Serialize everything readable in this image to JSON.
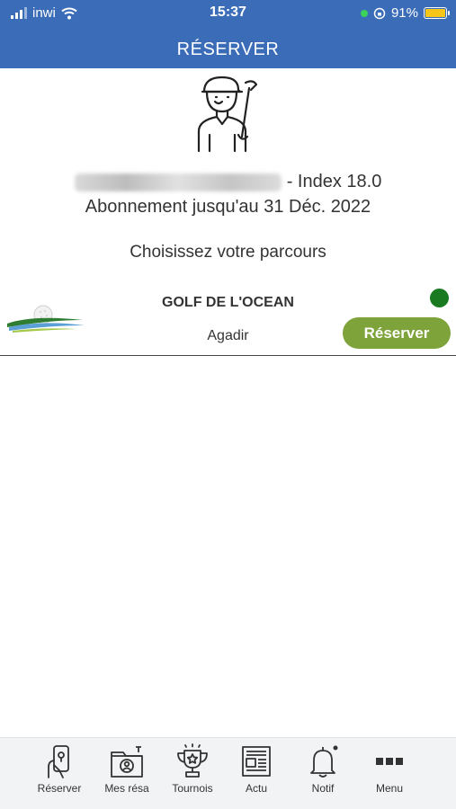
{
  "status_bar": {
    "carrier": "inwi",
    "time": "15:37",
    "battery": "91%",
    "battery_color": "#f5c518"
  },
  "header": {
    "title": "RÉSERVER",
    "color": "#3b6cb8"
  },
  "profile": {
    "index_text": "- Index 18.0",
    "subscription": "Abonnement jusqu'au 31 Déc. 2022",
    "avatar_icon": "golfer-icon"
  },
  "choose_course": "Choisissez votre parcours",
  "courses": [
    {
      "name": "GOLF DE L'OCEAN",
      "city": "Agadir",
      "logo_text": "GOLF DE L'OCEAN",
      "status_color": "#1a7a22",
      "button_label": "Réserver",
      "button_color": "#7ea33a"
    }
  ],
  "tabs": [
    {
      "label": "Réserver",
      "icon": "phone-hand-icon"
    },
    {
      "label": "Mes résa",
      "icon": "folder-user-icon"
    },
    {
      "label": "Tournois",
      "icon": "trophy-icon"
    },
    {
      "label": "Actu",
      "icon": "newspaper-icon"
    },
    {
      "label": "Notif",
      "icon": "bell-icon"
    },
    {
      "label": "Menu",
      "icon": "more-dots-icon"
    }
  ]
}
